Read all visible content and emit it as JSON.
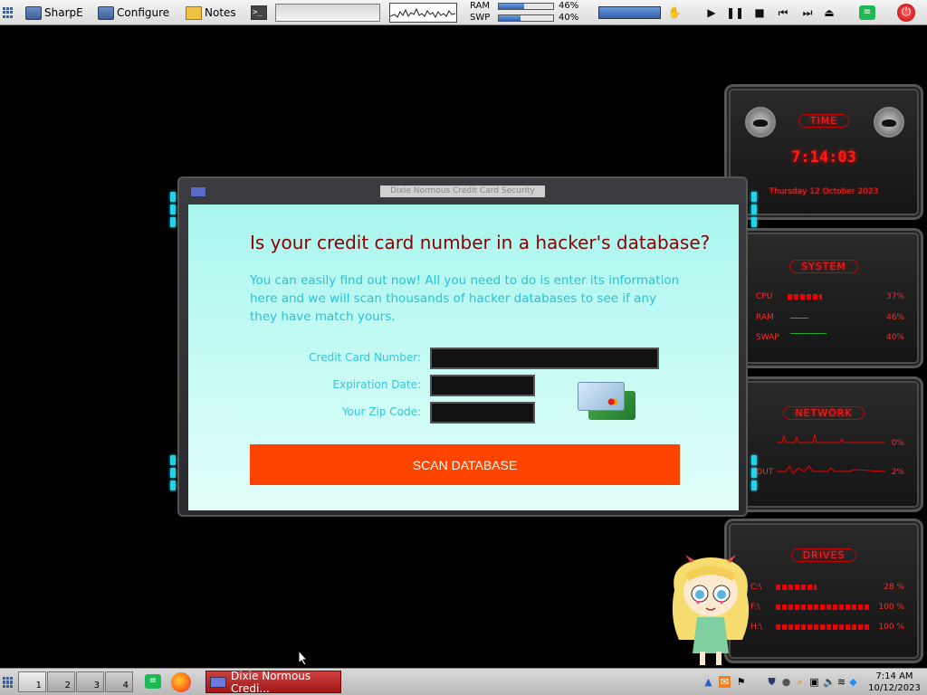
{
  "top_panel": {
    "launchers": [
      {
        "label": "SharpE",
        "icon": "monitor-icon"
      },
      {
        "label": "Configure",
        "icon": "monitor-icon"
      },
      {
        "label": "Notes",
        "icon": "notes-icon"
      }
    ],
    "terminal_glyph": ">_",
    "meters": {
      "ram_label": "RAM",
      "ram_pct": "46%",
      "ram_fraction": 0.46,
      "swp_label": "SWP",
      "swp_pct": "40%",
      "swp_fraction": 0.4
    },
    "media_buttons": [
      "play",
      "pause",
      "stop",
      "previous",
      "next"
    ]
  },
  "widgets": {
    "time": {
      "title": "TIME",
      "clock": "7:14:03",
      "date": "Thursday 12 October 2023"
    },
    "system": {
      "title": "SYSTEM",
      "rows": [
        {
          "label": "CPU",
          "value": "37%"
        },
        {
          "label": "RAM",
          "value": "46%"
        },
        {
          "label": "SWAP",
          "value": "40%"
        }
      ]
    },
    "network": {
      "title": "NETWORK",
      "rows": [
        {
          "label": "",
          "value": "0%"
        },
        {
          "label": "OUT",
          "value": "2%"
        }
      ]
    },
    "drives": {
      "title": "DRIVES",
      "rows": [
        {
          "label": "C:\\",
          "value": "28 %"
        },
        {
          "label": "F:\\",
          "value": "100 %"
        },
        {
          "label": "H:\\",
          "value": "100 %"
        }
      ]
    }
  },
  "dialog": {
    "window_title": "Dixie Normous Credit Card Security",
    "headline": "Is your credit card number in a hacker's database?",
    "description": "You can easily find out now! All you need to do is enter its information here and we will scan thousands of hacker databases to see if any they have match yours.",
    "fields": {
      "card_number_label": "Credit Card Number:",
      "expiration_label": "Expiration Date:",
      "zip_label": "Your Zip Code:",
      "card_number_value": "",
      "expiration_value": "",
      "zip_value": ""
    },
    "scan_button": "SCAN DATABASE",
    "colors": {
      "headline": "#8b0000",
      "text": "#29c2d8",
      "button": "#ff4400"
    }
  },
  "taskbar": {
    "workspaces": [
      "1",
      "2",
      "3",
      "4"
    ],
    "active_task": "Dixie Normous Credi...",
    "clock_time": "7:14 AM",
    "clock_date": "10/12/2023"
  }
}
